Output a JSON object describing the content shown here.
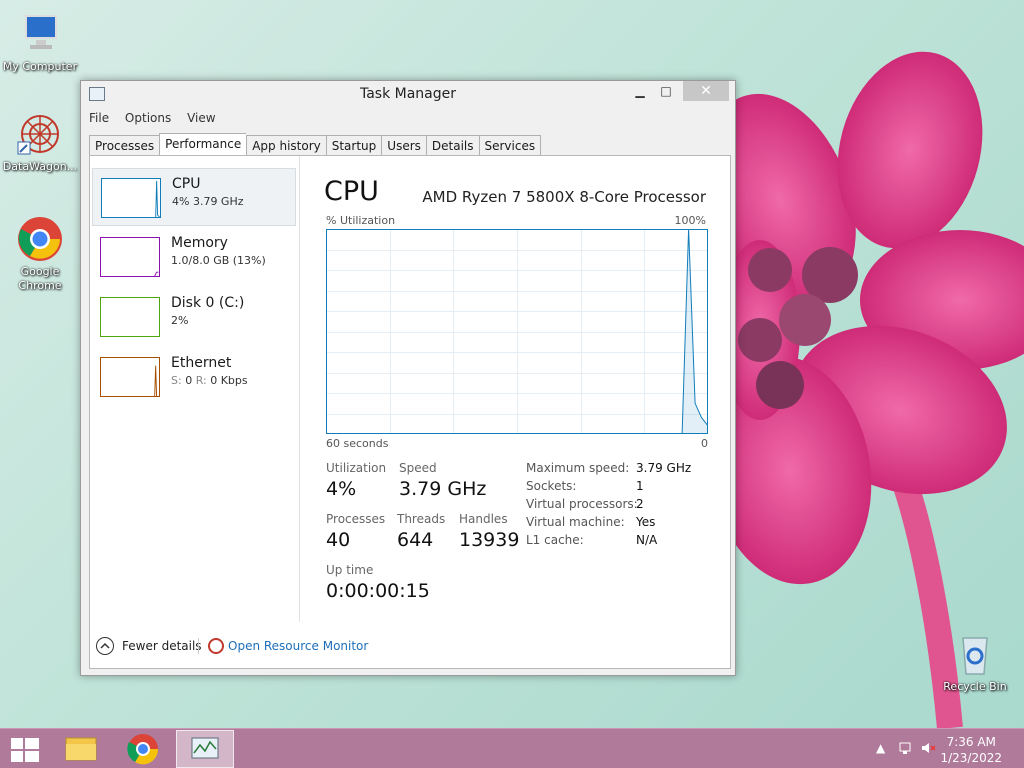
{
  "desktop": {
    "icons": [
      {
        "label": "My Computer"
      },
      {
        "label": "DataWagon..."
      },
      {
        "label": "Google Chrome"
      },
      {
        "label": "Recycle Bin"
      }
    ]
  },
  "window": {
    "title": "Task Manager",
    "controls": {
      "minimize": "▁",
      "maximize": "□",
      "close": "✕"
    }
  },
  "menu": [
    "File",
    "Options",
    "View"
  ],
  "tabs": [
    {
      "label": "Processes",
      "active": false
    },
    {
      "label": "Performance",
      "active": true
    },
    {
      "label": "App history",
      "active": false
    },
    {
      "label": "Startup",
      "active": false
    },
    {
      "label": "Users",
      "active": false
    },
    {
      "label": "Details",
      "active": false
    },
    {
      "label": "Services",
      "active": false
    }
  ],
  "resources": [
    {
      "name": "CPU",
      "sub": "4% 3.79 GHz",
      "color": "#117dbb",
      "selected": true
    },
    {
      "name": "Memory",
      "sub": "1.0/8.0 GB (13%)",
      "color": "#8b12ae",
      "selected": false
    },
    {
      "name": "Disk 0 (C:)",
      "sub": "2%",
      "color": "#4da60c",
      "selected": false
    },
    {
      "name": "Ethernet",
      "sub_s": "S:",
      "sub_s_val": "0",
      "sub_r": "R:",
      "sub_r_val": "0 Kbps",
      "color": "#a74f01",
      "selected": false
    }
  ],
  "cpu": {
    "title": "CPU",
    "model": "AMD Ryzen 7 5800X 8-Core Processor",
    "util_label": "% Utilization",
    "util_max": "100%",
    "axis_left": "60 seconds",
    "axis_right": "0",
    "history": [
      0,
      0,
      0,
      0,
      0,
      0,
      0,
      0,
      0,
      0,
      0,
      0,
      0,
      0,
      0,
      0,
      0,
      0,
      0,
      0,
      0,
      0,
      0,
      0,
      0,
      0,
      0,
      0,
      0,
      0,
      0,
      0,
      0,
      0,
      0,
      0,
      0,
      0,
      0,
      0,
      0,
      0,
      0,
      0,
      0,
      0,
      0,
      0,
      0,
      0,
      0,
      0,
      0,
      0,
      0,
      0,
      100,
      15,
      8,
      4
    ],
    "stats": {
      "utilization_label": "Utilization",
      "utilization": "4%",
      "speed_label": "Speed",
      "speed": "3.79 GHz",
      "processes_label": "Processes",
      "processes": "40",
      "threads_label": "Threads",
      "threads": "644",
      "handles_label": "Handles",
      "handles": "13939",
      "uptime_label": "Up time",
      "uptime": "0:00:00:15"
    },
    "specs": [
      {
        "key": "Maximum speed:",
        "value": "3.79 GHz"
      },
      {
        "key": "Sockets:",
        "value": "1"
      },
      {
        "key": "Virtual processors:",
        "value": "2"
      },
      {
        "key": "Virtual machine:",
        "value": "Yes"
      },
      {
        "key": "L1 cache:",
        "value": "N/A"
      }
    ]
  },
  "footer": {
    "fewer_details": "Fewer details",
    "open_resource_monitor": "Open Resource Monitor"
  },
  "taskbar": {
    "time": "7:36 AM",
    "date": "1/23/2022"
  },
  "colors": {
    "cpu_line": "#117dbb",
    "taskbar": "#b07a9a"
  }
}
